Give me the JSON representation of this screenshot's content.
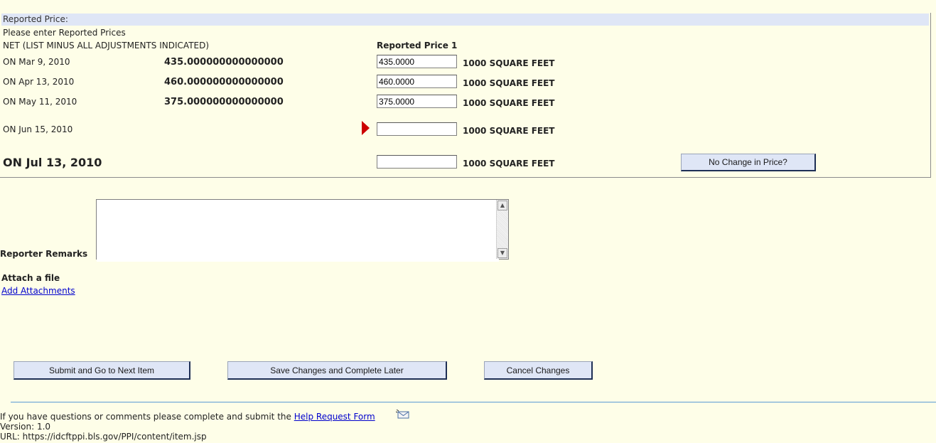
{
  "panel": {
    "header": "Reported Price:",
    "instruction": "Please enter Reported Prices",
    "basis": "NET (LIST MINUS ALL ADJUSTMENTS INDICATED)",
    "column_header": "Reported Price 1"
  },
  "rows": [
    {
      "date": "ON Mar 9, 2010",
      "prior": "435.000000000000000",
      "input": "435.0000",
      "unit": "1000 SQUARE FEET"
    },
    {
      "date": "ON Apr 13, 2010",
      "prior": "460.000000000000000",
      "input": "460.0000",
      "unit": "1000 SQUARE FEET"
    },
    {
      "date": "ON May 11, 2010",
      "prior": "375.000000000000000",
      "input": "375.0000",
      "unit": "1000 SQUARE FEET"
    },
    {
      "date": "ON Jun 15, 2010",
      "prior": "",
      "input": "",
      "unit": "1000 SQUARE FEET"
    },
    {
      "date": "ON Jul 13, 2010",
      "prior": "",
      "input": "",
      "unit": "1000 SQUARE FEET"
    }
  ],
  "no_change_button": "No Change in Price?",
  "remarks": {
    "label": "Reporter Remarks",
    "value": ""
  },
  "attach": {
    "heading": "Attach a file",
    "link": "Add Attachments"
  },
  "buttons": {
    "submit": "Submit and Go to Next Item",
    "save": "Save Changes and Complete Later",
    "cancel": "Cancel Changes"
  },
  "footer": {
    "help_text": "If you have questions or comments please complete and submit the",
    "help_link": "Help Request Form",
    "version": "Version: 1.0",
    "url": "URL: https://idcftppi.bls.gov/PPI/content/item.jsp"
  },
  "icons": {
    "current_row_marker": "red-triangle-arrow",
    "help_form_icon": "envelope-icon"
  },
  "colors": {
    "background": "#fefee8",
    "header_band": "#dfe6f6",
    "marker": "#cc0000",
    "link": "#0000cc"
  }
}
